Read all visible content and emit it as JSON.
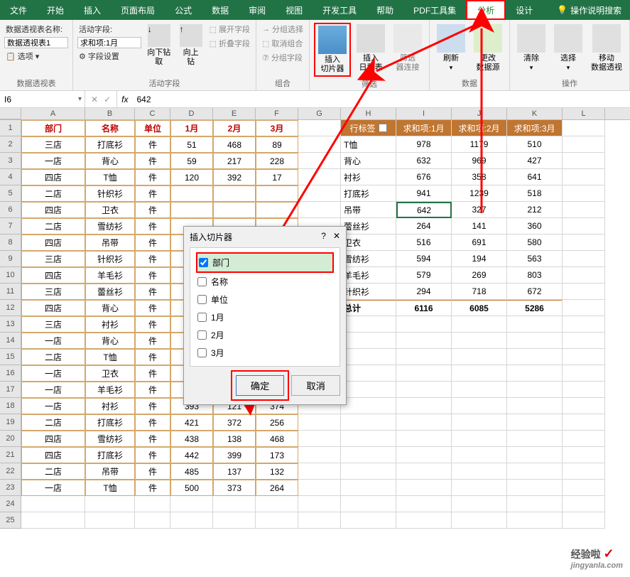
{
  "tabs": [
    "文件",
    "开始",
    "插入",
    "页面布局",
    "公式",
    "数据",
    "审阅",
    "视图",
    "开发工具",
    "帮助",
    "PDF工具集",
    "分析",
    "设计"
  ],
  "help_search": "操作说明搜索",
  "ribbon": {
    "pivot_name_label": "数据透视表名称:",
    "pivot_name_value": "数据透视表1",
    "options_label": "选项",
    "group_pivot": "数据透视表",
    "active_field_label": "活动字段:",
    "active_field_value": "求和项:1月",
    "field_settings": "字段设置",
    "drill_down": "向下钻取",
    "drill_up": "向上钻",
    "expand_field": "展开字段",
    "collapse_field": "折叠字段",
    "group_activefield": "活动字段",
    "group_select": "分组选择",
    "ungroup": "取消组合",
    "group_field": "分组字段",
    "group_group": "组合",
    "insert_slicer": "插入\n切片器",
    "insert_timeline": "插入\n日程表",
    "filter_conn": "筛选\n器连接",
    "group_filter": "筛选",
    "refresh": "刷新",
    "change_source": "更改\n数据源",
    "group_data": "数据",
    "clear": "清除",
    "select": "选择",
    "move": "移动\n数据透视",
    "group_actions": "操作"
  },
  "namebox": "I6",
  "formula_value": "642",
  "col_letters": [
    "A",
    "B",
    "C",
    "D",
    "E",
    "F",
    "G",
    "H",
    "I",
    "J",
    "K",
    "L"
  ],
  "row_numbers": [
    "1",
    "2",
    "3",
    "4",
    "5",
    "6",
    "7",
    "8",
    "9",
    "10",
    "11",
    "12",
    "13",
    "14",
    "15",
    "16",
    "17",
    "18",
    "19",
    "20",
    "21",
    "22",
    "23",
    "24",
    "25"
  ],
  "table_headers": [
    "部门",
    "名称",
    "单位",
    "1月",
    "2月",
    "3月"
  ],
  "table_rows": [
    [
      "三店",
      "打底衫",
      "件",
      "51",
      "468",
      "89"
    ],
    [
      "一店",
      "背心",
      "件",
      "59",
      "217",
      "228"
    ],
    [
      "四店",
      "T恤",
      "件",
      "120",
      "392",
      "17"
    ],
    [
      "二店",
      "针织衫",
      "件",
      "",
      "",
      ""
    ],
    [
      "四店",
      "卫衣",
      "件",
      "",
      "",
      ""
    ],
    [
      "二店",
      "雪纺衫",
      "件",
      "",
      "",
      ""
    ],
    [
      "四店",
      "吊带",
      "件",
      "",
      "",
      ""
    ],
    [
      "三店",
      "针织衫",
      "件",
      "",
      "",
      ""
    ],
    [
      "四店",
      "羊毛衫",
      "件",
      "",
      "",
      ""
    ],
    [
      "三店",
      "蕾丝衫",
      "件",
      "",
      "",
      ""
    ],
    [
      "四店",
      "背心",
      "件",
      "",
      "",
      ""
    ],
    [
      "三店",
      "衬衫",
      "件",
      "",
      "",
      ""
    ],
    [
      "一店",
      "背心",
      "件",
      "",
      "",
      ""
    ],
    [
      "二店",
      "T恤",
      "件",
      "",
      "",
      ""
    ],
    [
      "一店",
      "卫衣",
      "件",
      "",
      "",
      ""
    ],
    [
      "一店",
      "羊毛衫",
      "件",
      "",
      "",
      ""
    ],
    [
      "一店",
      "衬衫",
      "件",
      "393",
      "121",
      "374"
    ],
    [
      "二店",
      "打底衫",
      "件",
      "421",
      "372",
      "256"
    ],
    [
      "四店",
      "雪纺衫",
      "件",
      "438",
      "138",
      "468"
    ],
    [
      "四店",
      "打底衫",
      "件",
      "442",
      "399",
      "173"
    ],
    [
      "二店",
      "吊带",
      "件",
      "485",
      "137",
      "132"
    ],
    [
      "一店",
      "T恤",
      "件",
      "500",
      "373",
      "264"
    ]
  ],
  "pivot_headers": [
    "行标签",
    "求和项:1月",
    "求和项:2月",
    "求和项:3月"
  ],
  "pivot_rows": [
    [
      "T恤",
      "978",
      "1179",
      "510"
    ],
    [
      "背心",
      "632",
      "969",
      "427"
    ],
    [
      "衬衫",
      "676",
      "358",
      "641"
    ],
    [
      "打底衫",
      "941",
      "1239",
      "518"
    ],
    [
      "吊带",
      "642",
      "327",
      "212"
    ],
    [
      "蕾丝衫",
      "264",
      "141",
      "360"
    ],
    [
      "卫衣",
      "516",
      "691",
      "580"
    ],
    [
      "雪纺衫",
      "594",
      "194",
      "563"
    ],
    [
      "羊毛衫",
      "579",
      "269",
      "803"
    ],
    [
      "针织衫",
      "294",
      "718",
      "672"
    ]
  ],
  "pivot_total": [
    "总计",
    "6116",
    "6085",
    "5286"
  ],
  "dialog": {
    "title": "插入切片器",
    "help": "?",
    "close": "✕",
    "items": [
      "部门",
      "名称",
      "单位",
      "1月",
      "2月",
      "3月"
    ],
    "checked_index": 0,
    "ok": "确定",
    "cancel": "取消"
  },
  "watermark": {
    "text": "经验啦",
    "url": "jingyanla.com"
  }
}
